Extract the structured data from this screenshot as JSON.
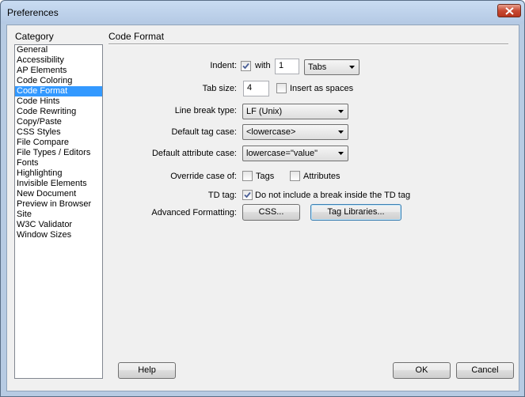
{
  "window": {
    "title": "Preferences"
  },
  "category": {
    "label": "Category",
    "items": [
      "General",
      "Accessibility",
      "AP Elements",
      "Code Coloring",
      "Code Format",
      "Code Hints",
      "Code Rewriting",
      "Copy/Paste",
      "CSS Styles",
      "File Compare",
      "File Types / Editors",
      "Fonts",
      "Highlighting",
      "Invisible Elements",
      "New Document",
      "Preview in Browser",
      "Site",
      "W3C Validator",
      "Window Sizes"
    ],
    "selected": "Code Format"
  },
  "panel": {
    "title": "Code Format",
    "indent": {
      "label": "Indent:",
      "checked": true,
      "with_label": "with",
      "value": "1",
      "unit": "Tabs"
    },
    "tab_size": {
      "label": "Tab size:",
      "value": "4",
      "insert_spaces_label": "Insert as spaces",
      "insert_spaces_checked": false
    },
    "line_break": {
      "label": "Line break type:",
      "value": "LF (Unix)"
    },
    "tag_case": {
      "label": "Default tag case:",
      "value": "<lowercase>"
    },
    "attr_case": {
      "label": "Default attribute case:",
      "value": "lowercase=\"value\""
    },
    "override": {
      "label": "Override case of:",
      "tags_label": "Tags",
      "tags_checked": false,
      "attrs_label": "Attributes",
      "attrs_checked": false
    },
    "td_tag": {
      "label": "TD tag:",
      "checked": true,
      "text": "Do not include a break inside the TD tag"
    },
    "advanced": {
      "label": "Advanced Formatting:",
      "css_button": "CSS...",
      "tag_libraries_button": "Tag Libraries..."
    }
  },
  "footer": {
    "help": "Help",
    "ok": "OK",
    "cancel": "Cancel"
  },
  "colors": {
    "selection": "#3399ff",
    "titlebar": "#c9dcf2",
    "close_button": "#c74a33"
  }
}
